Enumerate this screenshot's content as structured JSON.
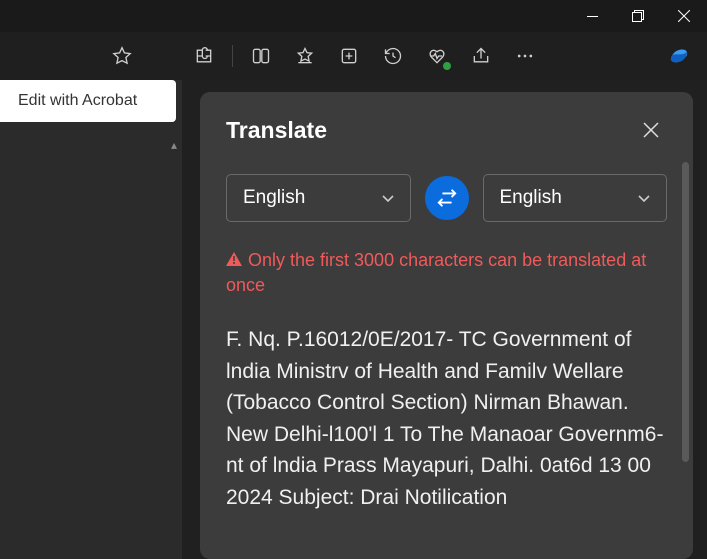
{
  "window": {
    "minimize": "Minimize",
    "maximize": "Restore",
    "close": "Close"
  },
  "toolbar": {
    "favorite": "Add to favorites",
    "extensions": "Extensions",
    "split": "Split screen",
    "favlist": "Favorites",
    "collections": "Collections",
    "history": "History",
    "performance": "Browser essentials",
    "share": "Share",
    "more": "Settings and more",
    "copilot": "Copilot"
  },
  "acrobat": {
    "label": "Edit with Acrobat"
  },
  "translate": {
    "title": "Translate",
    "close": "Close",
    "from_lang": "English",
    "to_lang": "English",
    "swap": "Swap languages",
    "warning": "Only the first 3000 characters can be translated at once",
    "source_text": "F. Nq. P.16012/0E/2017- TC Government of lndia Ministrv of Health and Familv Wellare (Tobacco Control Section) Nirman Bhawan. New Delhi-l100'l 1 To The Manaoar Governm6-nt of lndia Prass Mayapuri, Dalhi. 0at6d 13 00 2024 Subject: Drai Notilication"
  }
}
